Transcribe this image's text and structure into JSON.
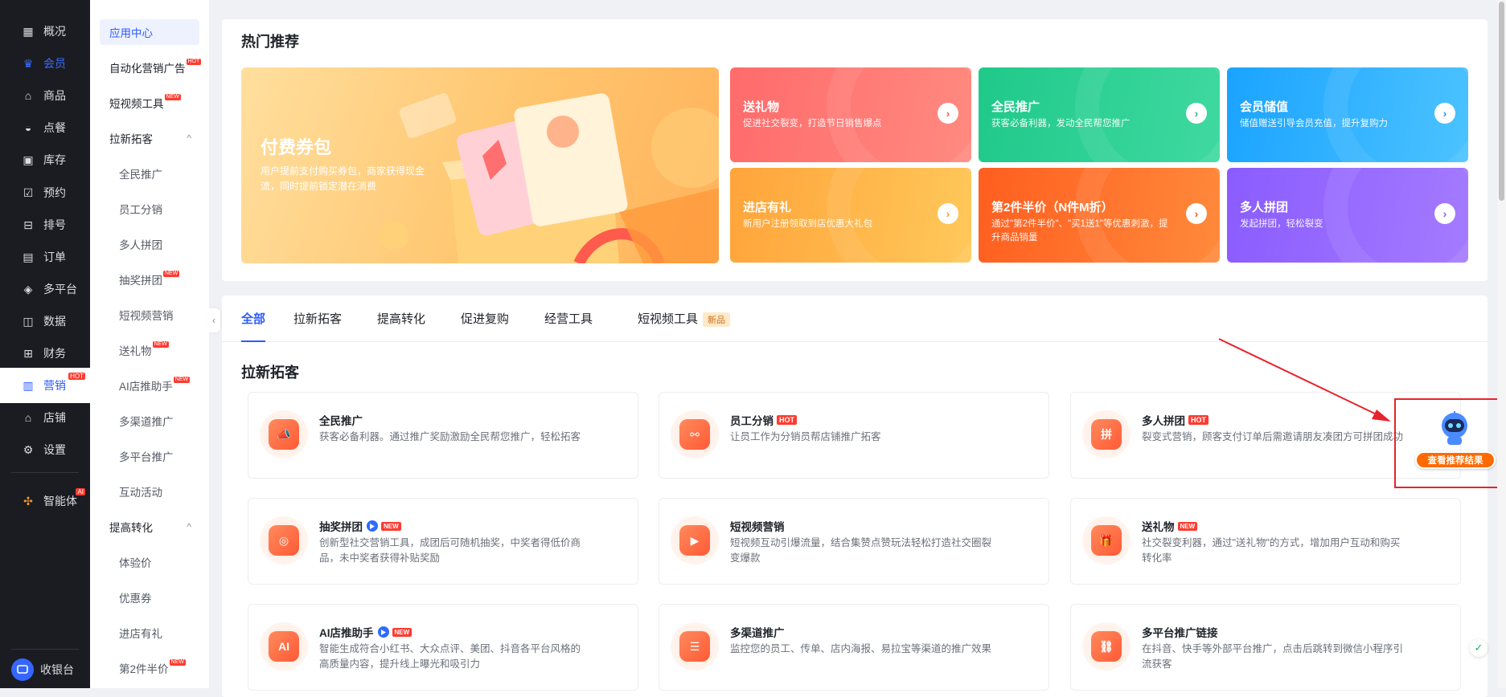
{
  "nav": {
    "items": [
      {
        "label": "概况",
        "icon": "grid-icon"
      },
      {
        "label": "会员",
        "icon": "crown-icon"
      },
      {
        "label": "商品",
        "icon": "shop-icon"
      },
      {
        "label": "点餐",
        "icon": "dish-icon"
      },
      {
        "label": "库存",
        "icon": "inventory-icon"
      },
      {
        "label": "预约",
        "icon": "calendar-check-icon"
      },
      {
        "label": "排号",
        "icon": "queue-icon"
      },
      {
        "label": "订单",
        "icon": "order-icon"
      },
      {
        "label": "多平台",
        "icon": "layers-icon"
      },
      {
        "label": "数据",
        "icon": "chart-icon"
      },
      {
        "label": "财务",
        "icon": "finance-icon"
      },
      {
        "label": "营销",
        "icon": "marketing-icon",
        "badge": "HOT"
      },
      {
        "label": "店铺",
        "icon": "store-icon"
      },
      {
        "label": "设置",
        "icon": "settings-icon"
      },
      {
        "label": "智能体",
        "icon": "agent-icon",
        "badge": "AI"
      }
    ],
    "cashier": "收银台",
    "active_color": "#2d5bff"
  },
  "submenu": {
    "items": [
      {
        "label": "应用中心"
      },
      {
        "label": "自动化营销广告",
        "badge": "HOT"
      },
      {
        "label": "短视频工具",
        "badge": "NEW"
      },
      {
        "label": "拉新拓客",
        "arrow": "^"
      },
      {
        "label": "全民推广"
      },
      {
        "label": "员工分销"
      },
      {
        "label": "多人拼团"
      },
      {
        "label": "抽奖拼团",
        "badge": "NEW"
      },
      {
        "label": "短视频营销"
      },
      {
        "label": "送礼物",
        "badge": "NEW"
      },
      {
        "label": "AI店推助手",
        "badge": "NEW"
      },
      {
        "label": "多渠道推广"
      },
      {
        "label": "多平台推广"
      },
      {
        "label": "互动活动"
      },
      {
        "label": "提高转化",
        "arrow": "^"
      },
      {
        "label": "体验价"
      },
      {
        "label": "优惠券"
      },
      {
        "label": "进店有礼"
      },
      {
        "label": "第2件半价",
        "badge": "NEW"
      }
    ],
    "collapse_icon": "‹"
  },
  "hot": {
    "title": "热门推荐",
    "banner": {
      "title": "付费券包",
      "desc": "用户提前支付购买券包，商家获得现金流，同时提前锁定潜在消费"
    },
    "cards": [
      {
        "title": "送礼物",
        "desc": "促进社交裂变，打造节日销售爆点",
        "color_from": "#ff6b6b",
        "color_to": "#ff8a80",
        "arrow_color": "#ff5a5a"
      },
      {
        "title": "全民推广",
        "desc": "获客必备利器，发动全民帮您推广",
        "color_from": "#1fc98a",
        "color_to": "#3fd9a0",
        "arrow_color": "#1fbf84"
      },
      {
        "title": "会员储值",
        "desc": "储值赠送引导会员充值，提升复购力",
        "color_from": "#1aa3ff",
        "color_to": "#4cc3ff",
        "arrow_color": "#1a9bff"
      },
      {
        "title": "进店有礼",
        "desc": "新用户注册领取到店优惠大礼包",
        "color_from": "#ffa43a",
        "color_to": "#ffc85a",
        "arrow_color": "#ff9a2e"
      },
      {
        "title": "第2件半价（N件M折）",
        "desc": "通过\"第2件半价\"、\"买1送1\"等优惠刺激，提升商品销量",
        "color_from": "#ff5e1f",
        "color_to": "#ff8a3c",
        "arrow_color": "#ff5a1f"
      },
      {
        "title": "多人拼团",
        "desc": "发起拼团，轻松裂变",
        "color_from": "#8a5cff",
        "color_to": "#a47bff",
        "arrow_color": "#8a5cff"
      }
    ]
  },
  "tabs": [
    {
      "label": "全部",
      "active": true
    },
    {
      "label": "拉新拓客"
    },
    {
      "label": "提高转化"
    },
    {
      "label": "促进复购"
    },
    {
      "label": "经营工具"
    },
    {
      "label": "短视频工具",
      "pill": "新品"
    }
  ],
  "section_title": "拉新拓客",
  "apps": [
    {
      "title": "全民推广",
      "desc": "获客必备利器。通过推广奖励激励全民帮您推广，轻松拓客",
      "icon": "megaphone-icon",
      "glyph": "📣"
    },
    {
      "title": "员工分销",
      "tag": "HOT",
      "desc": "让员工作为分销员帮店铺推广拓客",
      "icon": "distribution-icon",
      "glyph": "⚯"
    },
    {
      "title": "多人拼团",
      "tag": "HOT",
      "desc": "裂变式营销，顾客支付订单后需邀请朋友凑团方可拼团成功",
      "icon": "group-buy-icon",
      "glyph": "拼"
    },
    {
      "title": "抽奖拼团",
      "play": true,
      "tag": "NEW",
      "desc": "创新型社交营销工具，成团后可随机抽奖，中奖者得低价商品，未中奖者获得补贴奖励",
      "icon": "lottery-icon",
      "glyph": "◎"
    },
    {
      "title": "短视频营销",
      "desc": "短视频互动引爆流量，结合集赞点赞玩法轻松打造社交圈裂变爆款",
      "icon": "video-icon",
      "glyph": "▶"
    },
    {
      "title": "送礼物",
      "tag": "NEW",
      "desc": "社交裂变利器，通过\"送礼物\"的方式，增加用户互动和购买转化率",
      "icon": "gift-icon",
      "glyph": "🎁"
    },
    {
      "title": "AI店推助手",
      "play": true,
      "tag": "NEW",
      "desc": "智能生成符合小红书、大众点评、美团、抖音各平台风格的高质量内容，提升线上曝光和吸引力",
      "icon": "ai-icon",
      "glyph": "AI"
    },
    {
      "title": "多渠道推广",
      "desc": "监控您的员工、传单、店内海报、易拉宝等渠道的推广效果",
      "icon": "channel-icon",
      "glyph": "☰"
    },
    {
      "title": "多平台推广链接",
      "desc": "在抖音、快手等外部平台推广，点击后跳转到微信小程序引流获客",
      "icon": "link-icon",
      "glyph": "⛓"
    }
  ],
  "recommend_button": "查看推荐结果",
  "annotation_color": "#e8232b"
}
